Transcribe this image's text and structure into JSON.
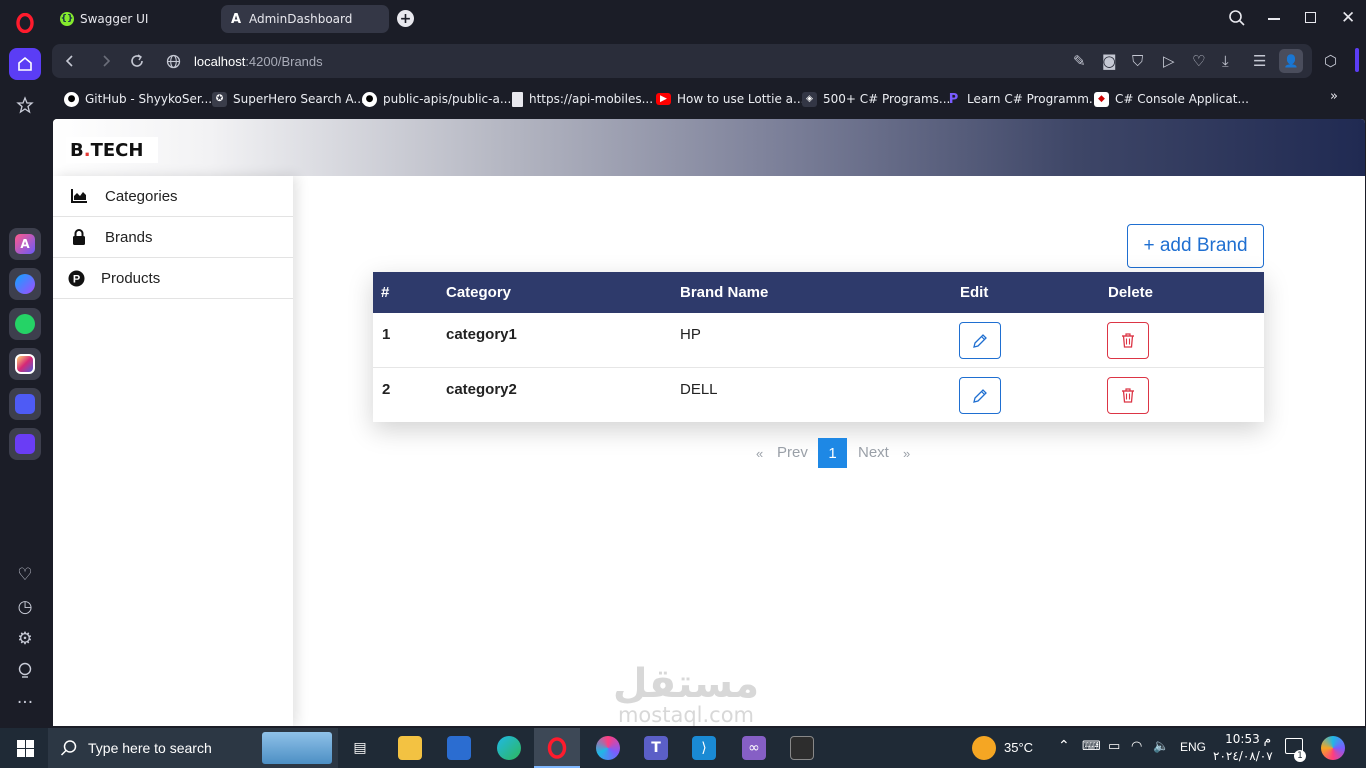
{
  "browser": {
    "tabs": [
      {
        "title": "Swagger UI",
        "active": false
      },
      {
        "title": "AdminDashboard",
        "active": true
      }
    ],
    "url_host": "localhost",
    "url_path": ":4200/Brands",
    "bookmarks": [
      {
        "label": "GitHub - ShyykoSer...",
        "icon": "github-icon"
      },
      {
        "label": "SuperHero Search A...",
        "icon": "superhero-icon"
      },
      {
        "label": "public-apis/public-a...",
        "icon": "github-icon"
      },
      {
        "label": "https://api-mobiles...",
        "icon": "document-icon"
      },
      {
        "label": "How to use Lottie a...",
        "icon": "youtube-icon"
      },
      {
        "label": "500+ C# Programs...",
        "icon": "csharp-site-icon"
      },
      {
        "label": "Learn C# Programm...",
        "icon": "learn-site-icon"
      },
      {
        "label": "C# Console Applicat...",
        "icon": "console-site-icon"
      }
    ]
  },
  "app": {
    "logo_left": "B",
    "logo_dot": ".",
    "logo_right": "TECH",
    "sidebar": [
      {
        "label": "Categories",
        "icon": "chart-icon"
      },
      {
        "label": "Brands",
        "icon": "lock-icon"
      },
      {
        "label": "Products",
        "icon": "product-p-icon"
      }
    ],
    "add_button": "+ add Brand",
    "table": {
      "headers": [
        "#",
        "Category",
        "Brand Name",
        "Edit",
        "Delete"
      ],
      "rows": [
        {
          "num": "1",
          "category": "category1",
          "brand": "HP"
        },
        {
          "num": "2",
          "category": "category2",
          "brand": "DELL"
        }
      ]
    },
    "pagination": {
      "prev_arrow": "«",
      "prev": "Prev",
      "current": "1",
      "next": "Next",
      "next_arrow": "»"
    },
    "watermark": {
      "arabic": "مستقل",
      "latin": "mostaql.com"
    }
  },
  "taskbar": {
    "search_placeholder": "Type here to search",
    "temperature": "35°C",
    "language": "ENG",
    "time": "10:53 م",
    "date": "٢٠٢٤/٠٨/٠٧",
    "notifications": "1"
  },
  "colors": {
    "accent": "#1f6fd1",
    "table_header": "#2e3a6b",
    "danger": "#dc3545",
    "pager_active": "#1e88e5"
  }
}
